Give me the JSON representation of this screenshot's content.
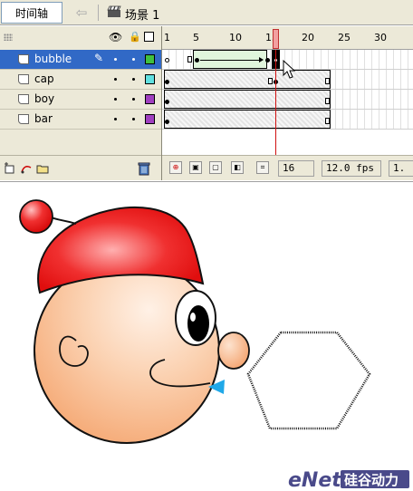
{
  "toolbar": {
    "timeline_label": "时间轴",
    "scene_label": "场景 1"
  },
  "layer_header": {
    "eye_icon": "eye-icon",
    "lock_icon": "lock-icon",
    "outline_icon": "outline-icon"
  },
  "layers": [
    {
      "name": "bubble",
      "color": "#40c040",
      "selected": true
    },
    {
      "name": "cap",
      "color": "#60e0e0",
      "selected": false
    },
    {
      "name": "boy",
      "color": "#a040c0",
      "selected": false
    },
    {
      "name": "bar",
      "color": "#a040c0",
      "selected": false
    }
  ],
  "ruler": {
    "ticks": [
      "1",
      "5",
      "10",
      "15",
      "20",
      "25",
      "30"
    ],
    "current_frame_marker": "16"
  },
  "status": {
    "current_frame": "16",
    "frame_rate": "12.0 fps",
    "elapsed": "1."
  },
  "colors": {
    "selection": "#3169c6",
    "tween_fill": "#e0f5dc",
    "playhead": "#d01010",
    "cap_red": "#e81818",
    "skin": "#f9c7a1",
    "beak": "#20a8e8"
  },
  "watermark": {
    "text_latin": "eNet",
    "text_cjk": "硅谷动力"
  }
}
